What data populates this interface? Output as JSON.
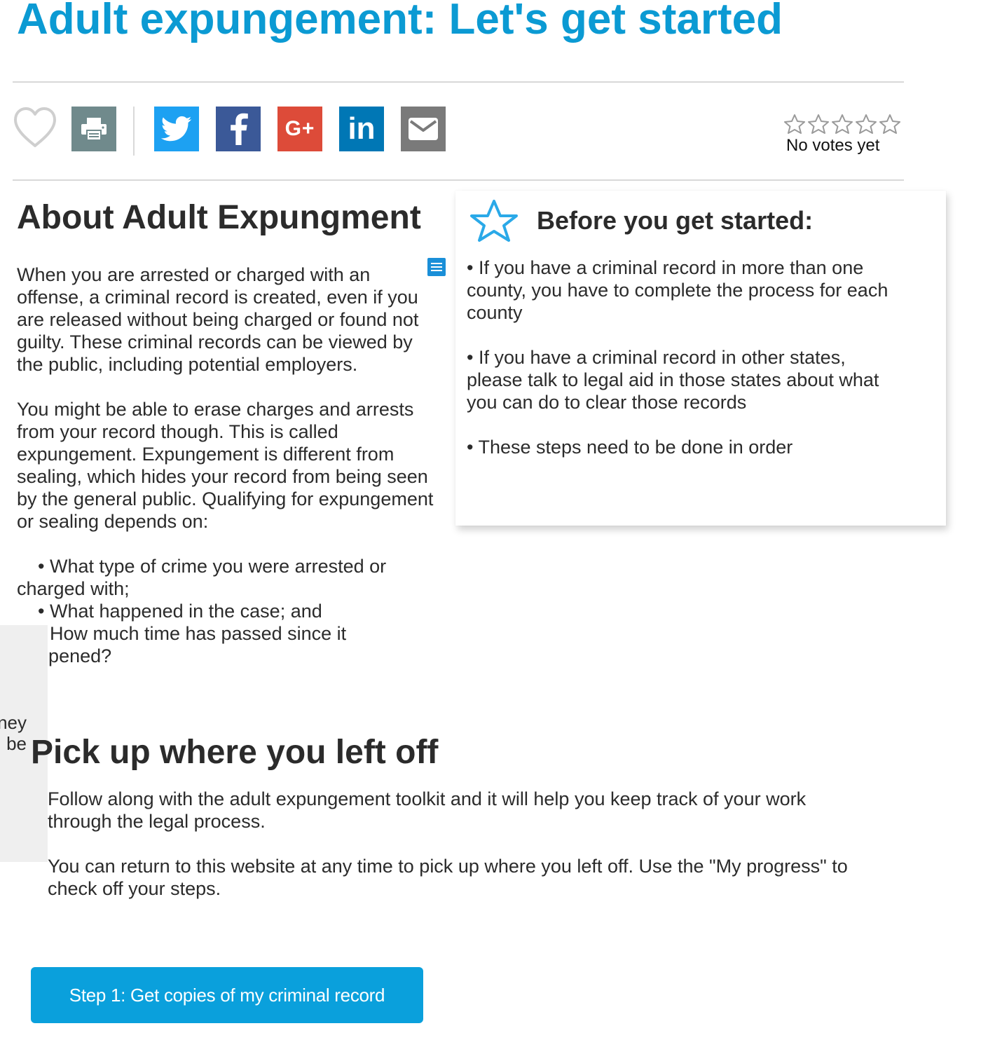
{
  "page": {
    "title": "Adult expungement: Let's get started"
  },
  "toolbar": {
    "items": [
      {
        "name": "favorite",
        "icon": "heart-icon",
        "color": "#cfcfcf"
      },
      {
        "name": "print",
        "icon": "printer-icon",
        "color": "#708a8c"
      },
      {
        "name": "twitter",
        "icon": "twitter-icon",
        "color": "#1da1f2"
      },
      {
        "name": "facebook",
        "icon": "facebook-icon",
        "color": "#3b5998"
      },
      {
        "name": "google-plus",
        "icon": "google-plus-icon",
        "color": "#dd4b39"
      },
      {
        "name": "linkedin",
        "icon": "linkedin-icon",
        "color": "#0077b5"
      },
      {
        "name": "email",
        "icon": "envelope-icon",
        "color": "#7a7a7a"
      }
    ],
    "google_plus_label": "G+",
    "linkedin_label": "in"
  },
  "rating": {
    "stars": 5,
    "value": 0,
    "votes_text": "No votes yet"
  },
  "about": {
    "heading": "About Adult Expungment",
    "icon": "list-icon",
    "paragraph1": "When you are arrested or charged with an offense, a criminal record is created, even if you are released without being charged or found not guilty. These criminal records can be viewed by the public, including potential employers.",
    "paragraph2": "You might be able to erase charges and arrests from your record though. This is called expungement. Expungement is different from sealing, which hides your record from being seen by the general public. Qualifying for expungement or sealing depends on:",
    "bullets": [
      "What type of crime you were arrested or charged with;",
      "What happened in the case; and",
      "How much time has passed since it happened?"
    ]
  },
  "before": {
    "icon": "star-outline-icon",
    "heading": "Before you get started:",
    "items": [
      "• If you have a criminal record in more than one county, you have to complete the process for each county",
      "• If you have a criminal record in other states, please talk to legal aid in those states about what you can do to clear those records",
      "• These steps need to be done in order"
    ]
  },
  "sidetab": {
    "line1": "ney",
    "line2": "be"
  },
  "pickup": {
    "heading": "Pick up where you left off",
    "paragraph1": "Follow along with the adult expungement toolkit and it will help you keep track of your work through the legal process.",
    "paragraph2": "You can return to this website at any time to pick up where you left off.  Use the \"My progress\" to check off your steps."
  },
  "cta": {
    "label": "Step 1: Get copies of my criminal record",
    "color": "#0aa0dc"
  },
  "colors": {
    "title": "#0b9ad3",
    "text": "#2b2b2b",
    "rule": "#d8d8d8",
    "star_accent": "#2aa9e8"
  }
}
